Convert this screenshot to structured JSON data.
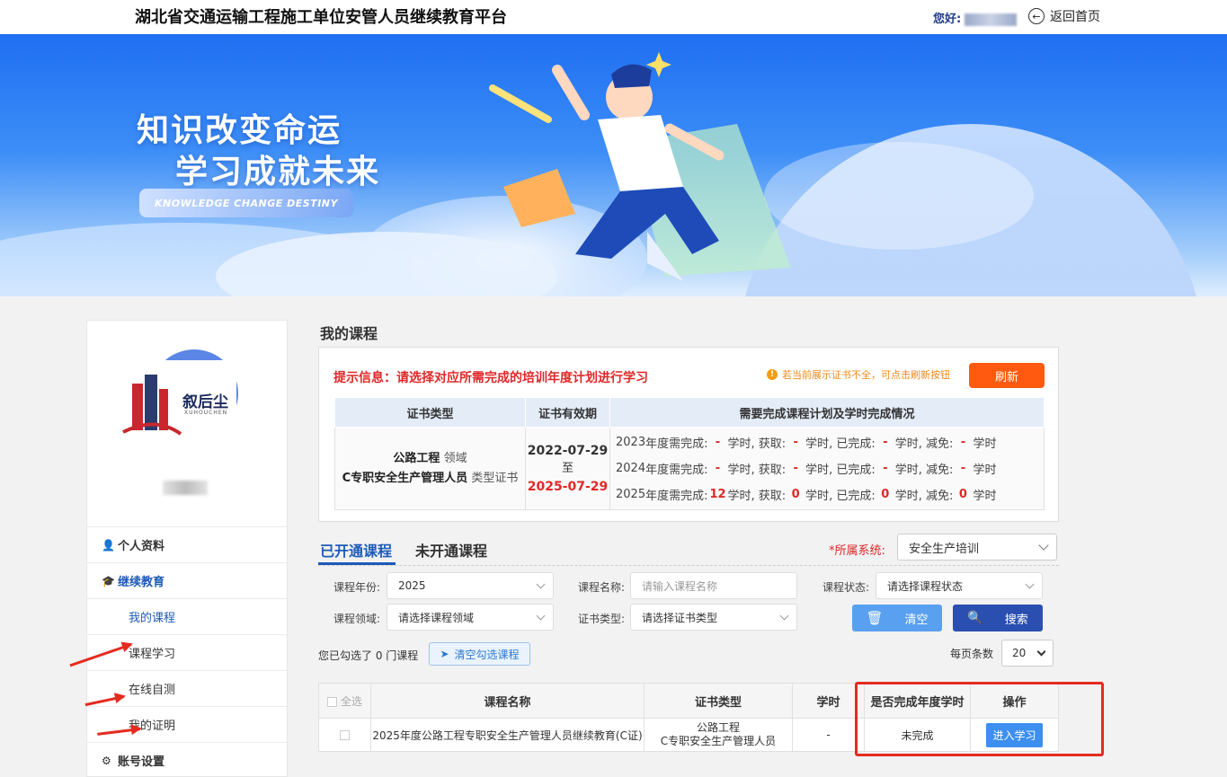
{
  "header": {
    "site_title": "湖北省交通运输工程施工单位安管人员继续教育平台",
    "greeting": "您好:",
    "back_home": "返回首页"
  },
  "banner": {
    "slogan_line1": "知识改变命运",
    "slogan_line2": "学习成就未来",
    "tagline": "KNOWLEDGE CHANGE DESTINY"
  },
  "sidebar": {
    "logo_text": "叙后尘",
    "logo_sub": "XUHOUCHEN",
    "menu": [
      {
        "label": "个人资料",
        "icon": "user-icon"
      },
      {
        "label": "继续教育",
        "icon": "graduation-cap-icon"
      },
      {
        "label": "我的课程"
      },
      {
        "label": "课程学习"
      },
      {
        "label": "在线自测"
      },
      {
        "label": "我的证明"
      },
      {
        "label": "账号设置",
        "icon": "gear-icon"
      }
    ]
  },
  "main": {
    "title": "我的课程",
    "tip": "提示信息：请选择对应所需完成的培训年度计划进行学习",
    "tip_right": "若当前展示证书不全，可点击刷新按钮",
    "refresh_label": "刷新",
    "cert_table": {
      "headers": [
        "证书类型",
        "证书有效期",
        "需要完成课程计划及学时完成情况"
      ],
      "domain_name": "公路工程",
      "domain_suffix": "领域",
      "cert_name": "C专职安全生产管理人员",
      "cert_suffix": "类型证书",
      "valid_from": "2022-07-29",
      "valid_to_word": "至",
      "valid_to": "2025-07-29",
      "labels": {
        "required": "年度需完成:",
        "unit_get": "学时, 获取:",
        "unit_done": "学时, 已完成:",
        "unit_reduce": "学时, 减免:",
        "unit_end": "学时"
      },
      "plans": [
        {
          "year": "2023",
          "required": "-",
          "obtained": "-",
          "completed": "-",
          "reduced": "-"
        },
        {
          "year": "2024",
          "required": "-",
          "obtained": "-",
          "completed": "-",
          "reduced": "-"
        },
        {
          "year": "2025",
          "required": "12",
          "obtained": "0",
          "completed": "0",
          "reduced": "0"
        }
      ]
    },
    "tabs": [
      "已开通课程",
      "未开通课程"
    ],
    "system_label": "*所属系统:",
    "system_value": "安全生产培训",
    "filters": {
      "year_label": "课程年份:",
      "year_value": "2025",
      "name_label": "课程名称:",
      "name_placeholder": "请输入课程名称",
      "status_label": "课程状态:",
      "status_placeholder": "请选择课程状态",
      "domain_label": "课程领域:",
      "domain_placeholder": "请选择课程领域",
      "cert_label": "证书类型:",
      "cert_placeholder": "请选择证书类型",
      "clear_label": "清空",
      "search_label": "搜索"
    },
    "selected_info": "您已勾选了 0 门课程",
    "clear_selected_label": "清空勾选课程",
    "pagesize_label": "每页条数",
    "pagesize_value": "20",
    "course_table": {
      "headers": [
        "全选",
        "课程名称",
        "证书类型",
        "学时",
        "是否完成年度学时",
        "操作"
      ],
      "rows": [
        {
          "name": "2025年度公路工程专职安全生产管理人员继续教育(C证)",
          "cert_line1": "公路工程",
          "cert_line2": "C专职安全生产管理人员",
          "hours": "-",
          "status": "未完成",
          "action": "进入学习"
        }
      ]
    }
  },
  "colors": {
    "brand_blue": "#1d5bb7",
    "alert_red": "#e02828",
    "refresh_orange": "#ff5a10",
    "annotation_red": "#e52b1f"
  }
}
